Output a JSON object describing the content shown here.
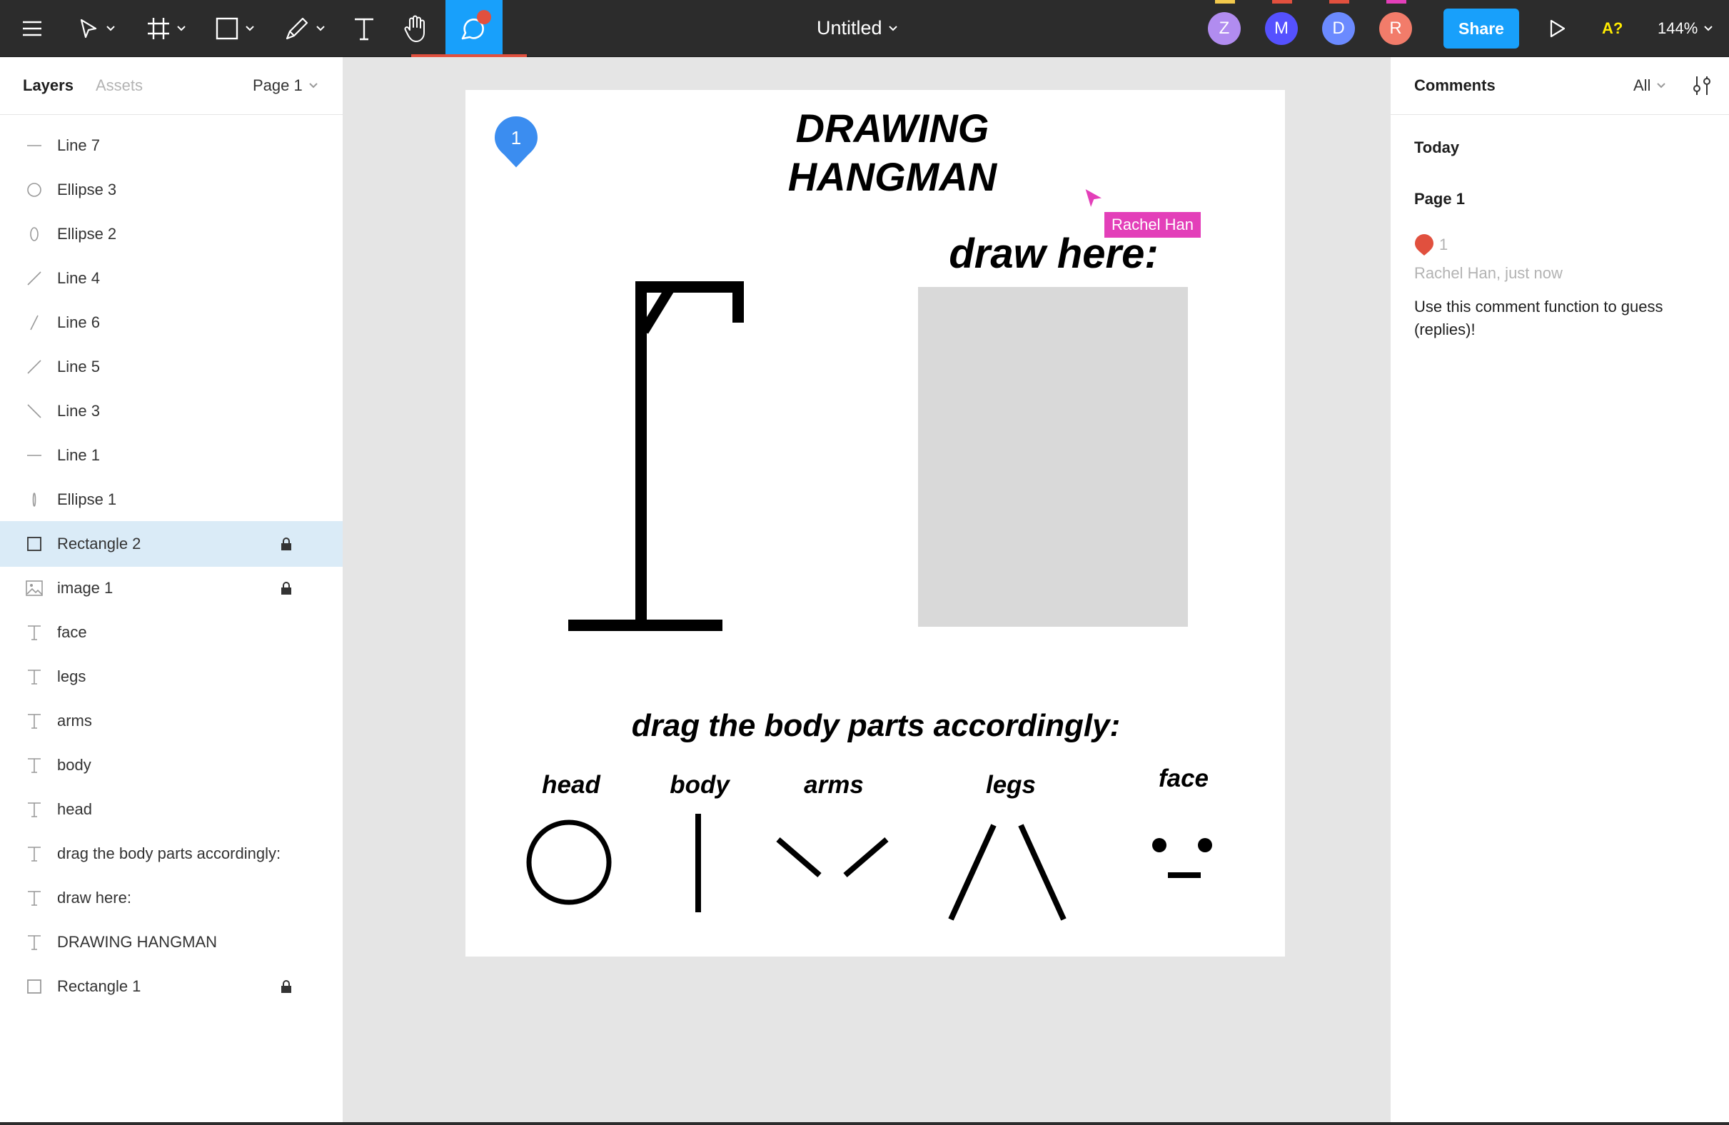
{
  "toolbar": {
    "document_title": "Untitled",
    "share_label": "Share",
    "accessibility_label": "A?",
    "zoom": "144%",
    "collaborators": [
      {
        "initial": "Z",
        "color": "#b18cf0"
      },
      {
        "initial": "M",
        "color": "#5551ff"
      },
      {
        "initial": "D",
        "color": "#6b8aff"
      },
      {
        "initial": "R",
        "color": "#f27c6a"
      }
    ],
    "icons": [
      "menu-icon",
      "move-tool-icon",
      "frame-tool-icon",
      "shape-tool-icon",
      "pen-tool-icon",
      "text-tool-icon",
      "hand-tool-icon",
      "comment-tool-icon",
      "present-icon"
    ]
  },
  "left_panel": {
    "tab_layers": "Layers",
    "tab_assets": "Assets",
    "page_select": "Page 1",
    "layers": [
      {
        "label": "Line 7",
        "icon": "line-horizontal-icon",
        "locked": false,
        "selected": false
      },
      {
        "label": "Ellipse 3",
        "icon": "ellipse-icon",
        "locked": false,
        "selected": false
      },
      {
        "label": "Ellipse 2",
        "icon": "ellipse-narrow-icon",
        "locked": false,
        "selected": false
      },
      {
        "label": "Line 4",
        "icon": "line-diagonal-icon",
        "locked": false,
        "selected": false
      },
      {
        "label": "Line 6",
        "icon": "line-steep-icon",
        "locked": false,
        "selected": false
      },
      {
        "label": "Line 5",
        "icon": "line-diagonal-icon",
        "locked": false,
        "selected": false
      },
      {
        "label": "Line 3",
        "icon": "line-backslash-icon",
        "locked": false,
        "selected": false
      },
      {
        "label": "Line 1",
        "icon": "line-horizontal-icon",
        "locked": false,
        "selected": false
      },
      {
        "label": "Ellipse 1",
        "icon": "ellipse-thin-icon",
        "locked": false,
        "selected": false
      },
      {
        "label": "Rectangle 2",
        "icon": "rectangle-icon",
        "locked": true,
        "selected": true
      },
      {
        "label": "image 1",
        "icon": "image-icon",
        "locked": true,
        "selected": false
      },
      {
        "label": "face",
        "icon": "text-icon",
        "locked": false,
        "selected": false
      },
      {
        "label": "legs",
        "icon": "text-icon",
        "locked": false,
        "selected": false
      },
      {
        "label": "arms",
        "icon": "text-icon",
        "locked": false,
        "selected": false
      },
      {
        "label": "body",
        "icon": "text-icon",
        "locked": false,
        "selected": false
      },
      {
        "label": "head",
        "icon": "text-icon",
        "locked": false,
        "selected": false
      },
      {
        "label": "drag the body parts accordingly:",
        "icon": "text-icon",
        "locked": false,
        "selected": false
      },
      {
        "label": "draw here:",
        "icon": "text-icon",
        "locked": false,
        "selected": false
      },
      {
        "label": "DRAWING HANGMAN",
        "icon": "text-icon",
        "locked": false,
        "selected": false
      },
      {
        "label": "Rectangle 1",
        "icon": "rectangle-icon",
        "locked": true,
        "selected": false
      }
    ]
  },
  "canvas": {
    "title_line1": "DRAWING",
    "title_line2": "HANGMAN",
    "draw_here": "draw here:",
    "drag_instruction": "drag the body parts accordingly:",
    "parts": {
      "head": "head",
      "body": "body",
      "arms": "arms",
      "legs": "legs",
      "face": "face"
    },
    "comment_pin_number": "1",
    "cursor_user": "Rachel Han",
    "help": "?"
  },
  "right_panel": {
    "title": "Comments",
    "filter": "All",
    "section_today": "Today",
    "page_label": "Page 1",
    "comment_number": "1",
    "comment_meta": "Rachel Han, just now",
    "comment_body": "Use this comment function to guess (replies)!"
  }
}
